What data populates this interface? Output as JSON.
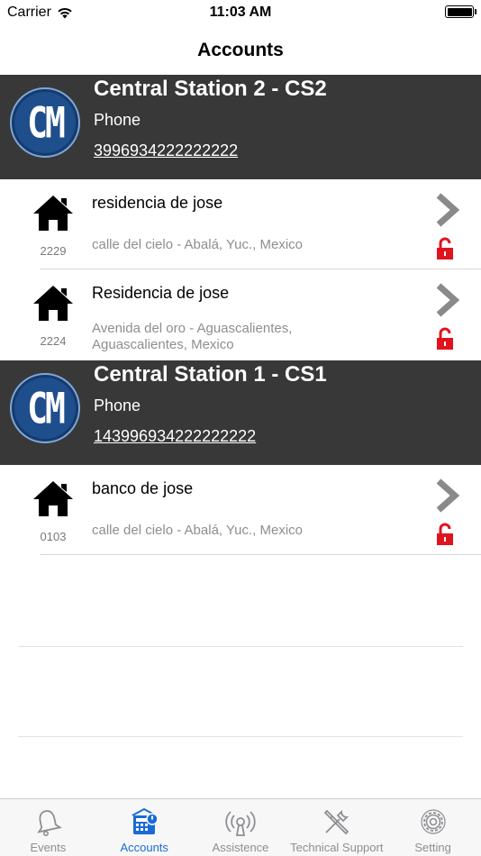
{
  "status_bar": {
    "carrier": "Carrier",
    "time": "11:03 AM"
  },
  "nav": {
    "title": "Accounts"
  },
  "stations": [
    {
      "name": "Central Station 2 - CS2",
      "logo_text": "CM",
      "phone_label": "Phone",
      "phone": "3996934222222222",
      "accounts": [
        {
          "name": "residencia de jose",
          "code": "2229",
          "address": "calle del cielo - Abalá, Yuc., Mexico"
        },
        {
          "name": "Residencia de jose",
          "code": "2224",
          "address": "Avenida del oro - Aguascalientes, Aguascalientes, Mexico"
        }
      ]
    },
    {
      "name": "Central Station 1 - CS1",
      "logo_text": "CM",
      "phone_label": "Phone",
      "phone": "143996934222222222",
      "accounts": [
        {
          "name": "banco de jose",
          "code": "0103",
          "address": "calle del cielo - Abalá, Yuc., Mexico"
        }
      ]
    }
  ],
  "tabs": [
    {
      "label": "Events",
      "icon": "bell-icon",
      "active": false
    },
    {
      "label": "Accounts",
      "icon": "alarm-panel-icon",
      "active": true
    },
    {
      "label": "Assistence",
      "icon": "alert-signal-icon",
      "active": false
    },
    {
      "label": "Technical Support",
      "icon": "tools-icon",
      "active": false
    },
    {
      "label": "Setting",
      "icon": "gear-icon",
      "active": false
    }
  ],
  "colors": {
    "header_bg": "#383838",
    "accent": "#1a6ad6",
    "lock_red": "#e0141e",
    "chevron_gray": "#8a8a8a"
  }
}
